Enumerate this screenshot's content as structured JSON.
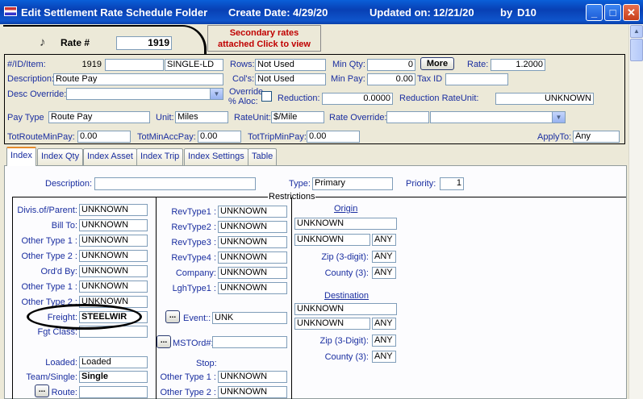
{
  "window": {
    "title": "Edit Settlement Rate Schedule Folder",
    "create_label": "Create Date:",
    "create_date": "4/29/20",
    "updated_label": "Updated on:",
    "updated_date": "12/21/20",
    "by_label": "by",
    "by_user": "D10"
  },
  "header": {
    "rate_label": "Rate #",
    "rate_number": "1919",
    "secondary_line1": "Secondary rates",
    "secondary_line2": "attached Click to view"
  },
  "form": {
    "item_label": "#/ID/Item:",
    "item_num": "1919",
    "item_id": "",
    "item_code": "SINGLE-LD",
    "rows_label": "Rows:",
    "rows_value": "Not Used",
    "min_qty_label": "Min Qty:",
    "min_qty_value": "0",
    "more_label": "More",
    "rate_label": "Rate:",
    "rate_value": "1.2000",
    "description_label": "Description:",
    "description_value": "Route Pay",
    "cols_label": "Col's:",
    "cols_value": "Not Used",
    "min_pay_label": "Min Pay:",
    "min_pay_value": "0.00",
    "tax_id_label": "Tax ID",
    "tax_id_value": "",
    "desc_override_label": "Desc Override:",
    "desc_override_value": "",
    "override_alloc_label1": "Override",
    "override_alloc_label2": "% Aloc:",
    "reduction_label": "Reduction:",
    "reduction_value": "0.0000",
    "reduction_unit_label": "Reduction RateUnit:",
    "reduction_unit_value": "UNKNOWN",
    "pay_type_label": "Pay Type",
    "pay_type_value": "Route Pay",
    "unit_label": "Unit:",
    "unit_value": "Miles",
    "rate_unit_label": "RateUnit:",
    "rate_unit_value": "$/Mile",
    "rate_override_label": "Rate Override:",
    "rate_override_value": "",
    "rate_override_select": "",
    "tot_route_label": "TotRouteMinPay:",
    "tot_route_value": "0.00",
    "tot_minacc_label": "TotMinAccPay:",
    "tot_minacc_value": "0.00",
    "tot_trip_label": "TotTripMinPay:",
    "tot_trip_value": "0.00",
    "apply_to_label": "ApplyTo:",
    "apply_to_value": "Any"
  },
  "tabs": [
    {
      "label": "Index"
    },
    {
      "label": "Index Qty"
    },
    {
      "label": "Index Asset"
    },
    {
      "label": "Index Trip"
    },
    {
      "label": "Index Settings"
    },
    {
      "label": "Table"
    }
  ],
  "index": {
    "description_label": "Description:",
    "description_value": "",
    "type_label": "Type:",
    "type_value": "Primary",
    "priority_label": "Priority:",
    "priority_value": "1",
    "restrictions_label": "Restrictions",
    "col1": [
      {
        "label": "Divis.of/Parent:",
        "value": "UNKNOWN"
      },
      {
        "label": "Bill To:",
        "value": "UNKNOWN"
      },
      {
        "label": "Other Type 1 :",
        "value": "UNKNOWN"
      },
      {
        "label": "Other Type 2 :",
        "value": "UNKNOWN"
      },
      {
        "label": "Ord'd By:",
        "value": "UNKNOWN"
      },
      {
        "label": "Other Type 1 :",
        "value": "UNKNOWN"
      },
      {
        "label": "Other Type 2 :",
        "value": "UNKNOWN"
      },
      {
        "label": "Freight:",
        "value": "STEELWIR"
      },
      {
        "label": "Fgt Class:",
        "value": ""
      }
    ],
    "loaded_label": "Loaded:",
    "loaded_value": "Loaded",
    "team_label": "Team/Single:",
    "team_value": "Single",
    "route_label": "Route:",
    "route_value": "",
    "col2": [
      {
        "label": "RevType1 :",
        "value": "UNKNOWN"
      },
      {
        "label": "RevType2 :",
        "value": "UNKNOWN"
      },
      {
        "label": "RevType3 :",
        "value": "UNKNOWN"
      },
      {
        "label": "RevType4 :",
        "value": "UNKNOWN"
      },
      {
        "label": "Company:",
        "value": "UNKNOWN"
      },
      {
        "label": "LghType1 :",
        "value": "UNKNOWN"
      }
    ],
    "event_label": "Event::",
    "event_value": "UNK",
    "mstord_label": "MSTOrd#:",
    "mstord_value": "",
    "stop_label": "Stop:",
    "stop_other1_label": "Other Type 1 :",
    "stop_other1_value": "UNKNOWN",
    "stop_other2_label": "Other Type 2 :",
    "stop_other2_value": "UNKNOWN",
    "origin_label": "Origin",
    "origin_value": "UNKNOWN",
    "origin_sub_value": "UNKNOWN",
    "origin_sub_any": "ANY",
    "origin_zip_label": "Zip (3-digit):",
    "origin_zip_value": "ANY",
    "origin_county_label": "County (3):",
    "origin_county_value": "ANY",
    "destination_label": "Destination",
    "dest_value": "UNKNOWN",
    "dest_sub_value": "UNKNOWN",
    "dest_sub_any": "ANY",
    "dest_zip_label": "Zip (3-Digit):",
    "dest_zip_value": "ANY",
    "dest_county_label": "County (3):",
    "dest_county_value": "ANY",
    "dots_label": "..."
  }
}
